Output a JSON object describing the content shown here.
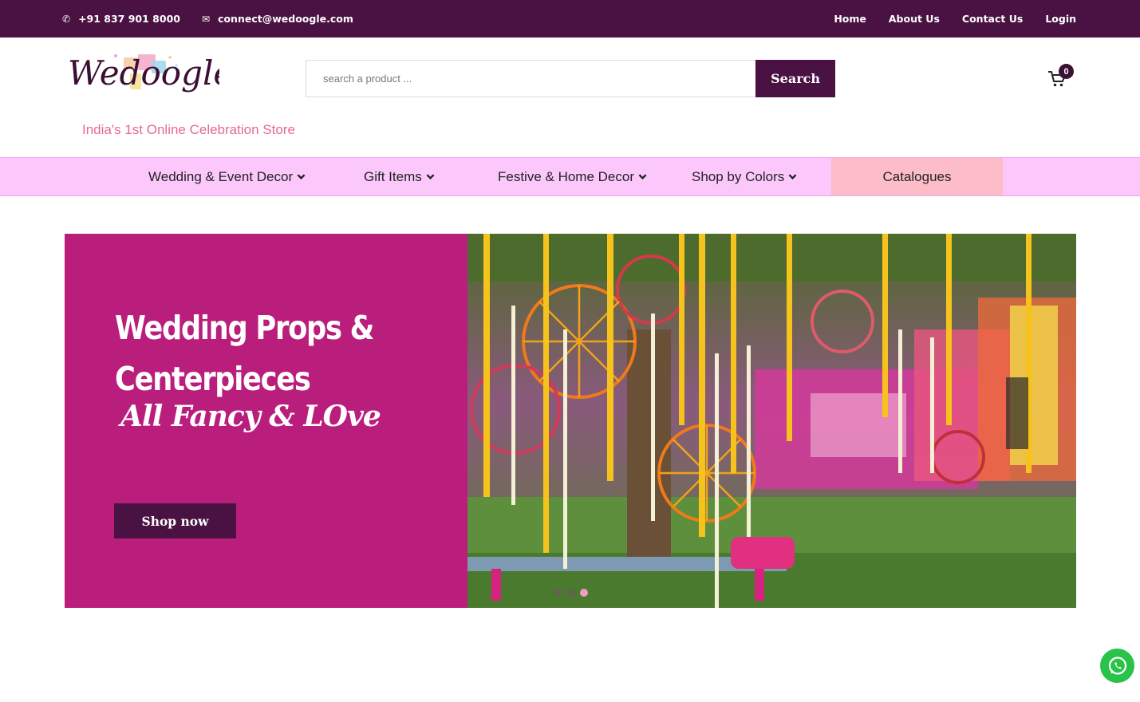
{
  "topbar": {
    "phone": "+91 837 901 8000",
    "email": "connect@wedoogle.com",
    "links": [
      "Home",
      "About Us",
      "Contact Us",
      "Login"
    ]
  },
  "header": {
    "logo_text": "Wedoogle",
    "tagline": "India's 1st Online Celebration Store",
    "search_placeholder": "search a product ...",
    "search_button": "Search",
    "cart_count": "0"
  },
  "mainnav": {
    "items": [
      "Wedding & Event Decor",
      "Gift Items",
      "Festive & Home Decor",
      "Shop by Colors",
      "Catalogues"
    ]
  },
  "hero": {
    "title_line1": "Wedding Props &",
    "title_line2": "Centerpieces",
    "script_line": "All Fancy & LOve",
    "button": "Shop now",
    "slide_count": 3,
    "active_slide": 3
  },
  "colors": {
    "brand_dark": "#4a1242",
    "hero_magenta": "#b91e7d",
    "nav_pink": "#fcc7fb",
    "tagline_pink": "#e46a92",
    "whatsapp_green": "#29c34a"
  }
}
